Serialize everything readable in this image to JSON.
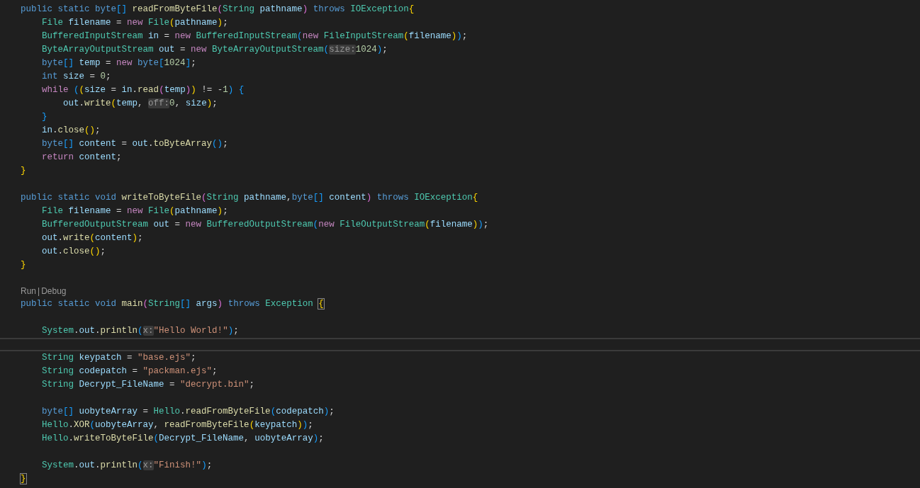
{
  "editor": {
    "lines": [
      {
        "kind": "code",
        "current": false,
        "tokens": [
          {
            "text": "public static byte",
            "kind": "keyword"
          },
          {
            "text": "[]",
            "kind": "bracket3"
          },
          {
            "text": " readFromByteFile",
            "kind": "function"
          },
          {
            "text": "(",
            "kind": "bracket2"
          },
          {
            "text": "String",
            "kind": "type"
          },
          {
            "text": " pathname",
            "kind": "variable"
          },
          {
            "text": ")",
            "kind": "bracket2"
          },
          {
            "text": " throws",
            "kind": "keyword"
          },
          {
            "text": " IOException",
            "kind": "type"
          },
          {
            "text": "{",
            "kind": "bracket1"
          }
        ]
      },
      {
        "kind": "code",
        "current": false,
        "tokens": [
          {
            "text": "    File",
            "kind": "type"
          },
          {
            "text": " filename",
            "kind": "variable"
          },
          {
            "text": " = ",
            "kind": "plain"
          },
          {
            "text": "new",
            "kind": "control"
          },
          {
            "text": " File",
            "kind": "type"
          },
          {
            "text": "(",
            "kind": "bracket1"
          },
          {
            "text": "pathname",
            "kind": "variable"
          },
          {
            "text": ")",
            "kind": "bracket1"
          },
          {
            "text": ";",
            "kind": "plain"
          }
        ]
      },
      {
        "kind": "code",
        "current": false,
        "tokens": [
          {
            "text": "    BufferedInputStream",
            "kind": "type"
          },
          {
            "text": " in",
            "kind": "variable"
          },
          {
            "text": " = ",
            "kind": "plain"
          },
          {
            "text": "new",
            "kind": "control"
          },
          {
            "text": " BufferedInputStream",
            "kind": "type"
          },
          {
            "text": "(",
            "kind": "bracket3"
          },
          {
            "text": "new",
            "kind": "control"
          },
          {
            "text": " FileInputStream",
            "kind": "type"
          },
          {
            "text": "(",
            "kind": "bracket1"
          },
          {
            "text": "filename",
            "kind": "variable"
          },
          {
            "text": ")",
            "kind": "bracket1"
          },
          {
            "text": ")",
            "kind": "bracket3"
          },
          {
            "text": ";",
            "kind": "plain"
          }
        ]
      },
      {
        "kind": "code",
        "current": false,
        "tokens": [
          {
            "text": "    ByteArrayOutputStream",
            "kind": "type"
          },
          {
            "text": " out",
            "kind": "variable"
          },
          {
            "text": " = ",
            "kind": "plain"
          },
          {
            "text": "new",
            "kind": "control"
          },
          {
            "text": " ByteArrayOutputStream",
            "kind": "type"
          },
          {
            "text": "(",
            "kind": "bracket3"
          },
          {
            "text": "size:",
            "kind": "hint"
          },
          {
            "text": "1024",
            "kind": "number"
          },
          {
            "text": ")",
            "kind": "bracket3"
          },
          {
            "text": ";",
            "kind": "plain"
          }
        ]
      },
      {
        "kind": "code",
        "current": false,
        "tokens": [
          {
            "text": "    byte",
            "kind": "keyword"
          },
          {
            "text": "[]",
            "kind": "bracket3"
          },
          {
            "text": " temp",
            "kind": "variable"
          },
          {
            "text": " = ",
            "kind": "plain"
          },
          {
            "text": "new",
            "kind": "control"
          },
          {
            "text": " byte",
            "kind": "keyword"
          },
          {
            "text": "[",
            "kind": "bracket3"
          },
          {
            "text": "1024",
            "kind": "number"
          },
          {
            "text": "]",
            "kind": "bracket3"
          },
          {
            "text": ";",
            "kind": "plain"
          }
        ]
      },
      {
        "kind": "code",
        "current": false,
        "tokens": [
          {
            "text": "    int",
            "kind": "keyword"
          },
          {
            "text": " size",
            "kind": "variable"
          },
          {
            "text": " = ",
            "kind": "plain"
          },
          {
            "text": "0",
            "kind": "number"
          },
          {
            "text": ";",
            "kind": "plain"
          }
        ]
      },
      {
        "kind": "code",
        "current": false,
        "tokens": [
          {
            "text": "    while",
            "kind": "control"
          },
          {
            "text": " (",
            "kind": "bracket3"
          },
          {
            "text": "(",
            "kind": "bracket1"
          },
          {
            "text": "size",
            "kind": "variable"
          },
          {
            "text": " = ",
            "kind": "plain"
          },
          {
            "text": "in",
            "kind": "variable"
          },
          {
            "text": ".",
            "kind": "plain"
          },
          {
            "text": "read",
            "kind": "function"
          },
          {
            "text": "(",
            "kind": "bracket2"
          },
          {
            "text": "temp",
            "kind": "variable"
          },
          {
            "text": ")",
            "kind": "bracket2"
          },
          {
            "text": ")",
            "kind": "bracket1"
          },
          {
            "text": " != -",
            "kind": "plain"
          },
          {
            "text": "1",
            "kind": "number"
          },
          {
            "text": ")",
            "kind": "bracket3"
          },
          {
            "text": " {",
            "kind": "bracket3"
          }
        ]
      },
      {
        "kind": "code",
        "current": false,
        "tokens": [
          {
            "text": "        out",
            "kind": "variable"
          },
          {
            "text": ".",
            "kind": "plain"
          },
          {
            "text": "write",
            "kind": "function"
          },
          {
            "text": "(",
            "kind": "bracket1"
          },
          {
            "text": "temp",
            "kind": "variable"
          },
          {
            "text": ", ",
            "kind": "plain"
          },
          {
            "text": "off:",
            "kind": "hint"
          },
          {
            "text": "0",
            "kind": "number"
          },
          {
            "text": ", ",
            "kind": "plain"
          },
          {
            "text": "size",
            "kind": "variable"
          },
          {
            "text": ")",
            "kind": "bracket1"
          },
          {
            "text": ";",
            "kind": "plain"
          }
        ]
      },
      {
        "kind": "code",
        "current": false,
        "tokens": [
          {
            "text": "    }",
            "kind": "bracket3"
          }
        ]
      },
      {
        "kind": "code",
        "current": false,
        "tokens": [
          {
            "text": "    in",
            "kind": "variable"
          },
          {
            "text": ".",
            "kind": "plain"
          },
          {
            "text": "close",
            "kind": "function"
          },
          {
            "text": "()",
            "kind": "bracket1"
          },
          {
            "text": ";",
            "kind": "plain"
          }
        ]
      },
      {
        "kind": "code",
        "current": false,
        "tokens": [
          {
            "text": "    byte",
            "kind": "keyword"
          },
          {
            "text": "[]",
            "kind": "bracket3"
          },
          {
            "text": " content",
            "kind": "variable"
          },
          {
            "text": " = ",
            "kind": "plain"
          },
          {
            "text": "out",
            "kind": "variable"
          },
          {
            "text": ".",
            "kind": "plain"
          },
          {
            "text": "toByteArray",
            "kind": "function"
          },
          {
            "text": "()",
            "kind": "bracket3"
          },
          {
            "text": ";",
            "kind": "plain"
          }
        ]
      },
      {
        "kind": "code",
        "current": false,
        "tokens": [
          {
            "text": "    return",
            "kind": "control"
          },
          {
            "text": " content",
            "kind": "variable"
          },
          {
            "text": ";",
            "kind": "plain"
          }
        ]
      },
      {
        "kind": "code",
        "current": false,
        "tokens": [
          {
            "text": "}",
            "kind": "bracket1"
          }
        ]
      },
      {
        "kind": "blank",
        "current": false
      },
      {
        "kind": "code",
        "current": false,
        "tokens": [
          {
            "text": "public static void",
            "kind": "keyword"
          },
          {
            "text": " writeToByteFile",
            "kind": "function"
          },
          {
            "text": "(",
            "kind": "bracket2"
          },
          {
            "text": "String",
            "kind": "type"
          },
          {
            "text": " pathname",
            "kind": "variable"
          },
          {
            "text": ",",
            "kind": "plain"
          },
          {
            "text": "byte",
            "kind": "keyword"
          },
          {
            "text": "[]",
            "kind": "bracket3"
          },
          {
            "text": " content",
            "kind": "variable"
          },
          {
            "text": ")",
            "kind": "bracket2"
          },
          {
            "text": " throws",
            "kind": "keyword"
          },
          {
            "text": " IOException",
            "kind": "type"
          },
          {
            "text": "{",
            "kind": "bracket1"
          }
        ]
      },
      {
        "kind": "code",
        "current": false,
        "tokens": [
          {
            "text": "    File",
            "kind": "type"
          },
          {
            "text": " filename",
            "kind": "variable"
          },
          {
            "text": " = ",
            "kind": "plain"
          },
          {
            "text": "new",
            "kind": "control"
          },
          {
            "text": " File",
            "kind": "type"
          },
          {
            "text": "(",
            "kind": "bracket1"
          },
          {
            "text": "pathname",
            "kind": "variable"
          },
          {
            "text": ")",
            "kind": "bracket1"
          },
          {
            "text": ";",
            "kind": "plain"
          }
        ]
      },
      {
        "kind": "code",
        "current": false,
        "tokens": [
          {
            "text": "    BufferedOutputStream",
            "kind": "type"
          },
          {
            "text": " out",
            "kind": "variable"
          },
          {
            "text": " = ",
            "kind": "plain"
          },
          {
            "text": "new",
            "kind": "control"
          },
          {
            "text": " BufferedOutputStream",
            "kind": "type"
          },
          {
            "text": "(",
            "kind": "bracket3"
          },
          {
            "text": "new",
            "kind": "control"
          },
          {
            "text": " FileOutputStream",
            "kind": "type"
          },
          {
            "text": "(",
            "kind": "bracket1"
          },
          {
            "text": "filename",
            "kind": "variable"
          },
          {
            "text": ")",
            "kind": "bracket1"
          },
          {
            "text": ")",
            "kind": "bracket3"
          },
          {
            "text": ";",
            "kind": "plain"
          }
        ]
      },
      {
        "kind": "code",
        "current": false,
        "tokens": [
          {
            "text": "    out",
            "kind": "variable"
          },
          {
            "text": ".",
            "kind": "plain"
          },
          {
            "text": "write",
            "kind": "function"
          },
          {
            "text": "(",
            "kind": "bracket1"
          },
          {
            "text": "content",
            "kind": "variable"
          },
          {
            "text": ")",
            "kind": "bracket1"
          },
          {
            "text": ";",
            "kind": "plain"
          }
        ]
      },
      {
        "kind": "code",
        "current": false,
        "tokens": [
          {
            "text": "    out",
            "kind": "variable"
          },
          {
            "text": ".",
            "kind": "plain"
          },
          {
            "text": "close",
            "kind": "function"
          },
          {
            "text": "()",
            "kind": "bracket1"
          },
          {
            "text": ";",
            "kind": "plain"
          }
        ]
      },
      {
        "kind": "code",
        "current": false,
        "tokens": [
          {
            "text": "}",
            "kind": "bracket1"
          }
        ]
      },
      {
        "kind": "blank",
        "current": false
      },
      {
        "kind": "codelens",
        "current": false,
        "links": [
          "Run",
          "Debug"
        ],
        "separator": "|"
      },
      {
        "kind": "code",
        "current": false,
        "tokens": [
          {
            "text": "public static void",
            "kind": "keyword"
          },
          {
            "text": " main",
            "kind": "function"
          },
          {
            "text": "(",
            "kind": "bracket2"
          },
          {
            "text": "String",
            "kind": "type"
          },
          {
            "text": "[]",
            "kind": "bracket3"
          },
          {
            "text": " args",
            "kind": "variable"
          },
          {
            "text": ")",
            "kind": "bracket2"
          },
          {
            "text": " throws",
            "kind": "keyword"
          },
          {
            "text": " Exception ",
            "kind": "type"
          },
          {
            "text": "{",
            "kind": "match"
          }
        ]
      },
      {
        "kind": "blank",
        "current": false
      },
      {
        "kind": "code",
        "current": false,
        "tokens": [
          {
            "text": "    System",
            "kind": "type"
          },
          {
            "text": ".",
            "kind": "plain"
          },
          {
            "text": "out",
            "kind": "variable"
          },
          {
            "text": ".",
            "kind": "plain"
          },
          {
            "text": "println",
            "kind": "function"
          },
          {
            "text": "(",
            "kind": "bracket3"
          },
          {
            "text": "x:",
            "kind": "hint"
          },
          {
            "text": "\"Hello World!\"",
            "kind": "string"
          },
          {
            "text": ")",
            "kind": "bracket3"
          },
          {
            "text": ";",
            "kind": "plain"
          }
        ]
      },
      {
        "kind": "blank",
        "current": true
      },
      {
        "kind": "code",
        "current": false,
        "tokens": [
          {
            "text": "    String",
            "kind": "type"
          },
          {
            "text": " keypatch",
            "kind": "variable"
          },
          {
            "text": " = ",
            "kind": "plain"
          },
          {
            "text": "\"base.ejs\"",
            "kind": "string"
          },
          {
            "text": ";",
            "kind": "plain"
          }
        ]
      },
      {
        "kind": "code",
        "current": false,
        "tokens": [
          {
            "text": "    String",
            "kind": "type"
          },
          {
            "text": " codepatch",
            "kind": "variable"
          },
          {
            "text": " = ",
            "kind": "plain"
          },
          {
            "text": "\"packman.ejs\"",
            "kind": "string"
          },
          {
            "text": ";",
            "kind": "plain"
          }
        ]
      },
      {
        "kind": "code",
        "current": false,
        "tokens": [
          {
            "text": "    String",
            "kind": "type"
          },
          {
            "text": " Decrypt_FileName",
            "kind": "variable"
          },
          {
            "text": " = ",
            "kind": "plain"
          },
          {
            "text": "\"decrypt.bin\"",
            "kind": "string"
          },
          {
            "text": ";",
            "kind": "plain"
          }
        ]
      },
      {
        "kind": "blank",
        "current": false
      },
      {
        "kind": "code",
        "current": false,
        "tokens": [
          {
            "text": "    byte",
            "kind": "keyword"
          },
          {
            "text": "[]",
            "kind": "bracket3"
          },
          {
            "text": " uobyteArray",
            "kind": "variable"
          },
          {
            "text": " = ",
            "kind": "plain"
          },
          {
            "text": "Hello",
            "kind": "type"
          },
          {
            "text": ".",
            "kind": "plain"
          },
          {
            "text": "readFromByteFile",
            "kind": "function"
          },
          {
            "text": "(",
            "kind": "bracket3"
          },
          {
            "text": "codepatch",
            "kind": "variable"
          },
          {
            "text": ")",
            "kind": "bracket3"
          },
          {
            "text": ";",
            "kind": "plain"
          }
        ]
      },
      {
        "kind": "code",
        "current": false,
        "tokens": [
          {
            "text": "    Hello",
            "kind": "type"
          },
          {
            "text": ".",
            "kind": "plain"
          },
          {
            "text": "XOR",
            "kind": "function"
          },
          {
            "text": "(",
            "kind": "bracket3"
          },
          {
            "text": "uobyteArray",
            "kind": "variable"
          },
          {
            "text": ", ",
            "kind": "plain"
          },
          {
            "text": "readFromByteFile",
            "kind": "function"
          },
          {
            "text": "(",
            "kind": "bracket1"
          },
          {
            "text": "keypatch",
            "kind": "variable"
          },
          {
            "text": ")",
            "kind": "bracket1"
          },
          {
            "text": ")",
            "kind": "bracket3"
          },
          {
            "text": ";",
            "kind": "plain"
          }
        ]
      },
      {
        "kind": "code",
        "current": false,
        "tokens": [
          {
            "text": "    Hello",
            "kind": "type"
          },
          {
            "text": ".",
            "kind": "plain"
          },
          {
            "text": "writeToByteFile",
            "kind": "function"
          },
          {
            "text": "(",
            "kind": "bracket3"
          },
          {
            "text": "Decrypt_FileName",
            "kind": "variable"
          },
          {
            "text": ", ",
            "kind": "plain"
          },
          {
            "text": "uobyteArray",
            "kind": "variable"
          },
          {
            "text": ")",
            "kind": "bracket3"
          },
          {
            "text": ";",
            "kind": "plain"
          }
        ]
      },
      {
        "kind": "blank",
        "current": false
      },
      {
        "kind": "code",
        "current": false,
        "tokens": [
          {
            "text": "    System",
            "kind": "type"
          },
          {
            "text": ".",
            "kind": "plain"
          },
          {
            "text": "out",
            "kind": "variable"
          },
          {
            "text": ".",
            "kind": "plain"
          },
          {
            "text": "println",
            "kind": "function"
          },
          {
            "text": "(",
            "kind": "bracket3"
          },
          {
            "text": "x:",
            "kind": "hint"
          },
          {
            "text": "\"Finish!\"",
            "kind": "string"
          },
          {
            "text": ")",
            "kind": "bracket3"
          },
          {
            "text": ";",
            "kind": "plain"
          }
        ]
      },
      {
        "kind": "code",
        "current": false,
        "tokens": [
          {
            "text": "}",
            "kind": "match"
          }
        ]
      }
    ]
  }
}
